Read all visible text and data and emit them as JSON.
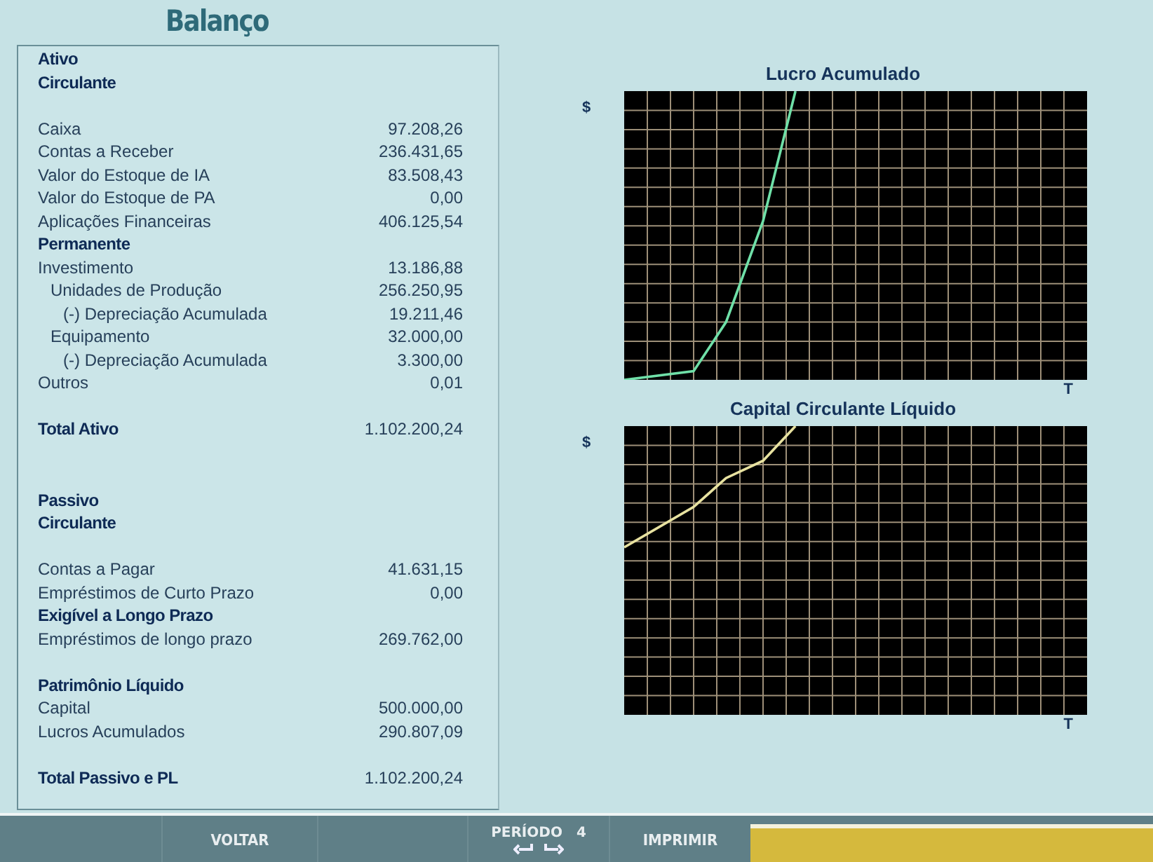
{
  "title": "Balanço",
  "assets": [
    {
      "kind": "heading",
      "label": "Ativo"
    },
    {
      "kind": "heading",
      "label": "Circulante"
    },
    {
      "kind": "item",
      "label": "Caixa",
      "value": "97.208,26",
      "spaced": true
    },
    {
      "kind": "item",
      "label": "Contas a Receber",
      "value": "236.431,65"
    },
    {
      "kind": "item",
      "label": "Valor do Estoque de IA",
      "value": "83.508,43"
    },
    {
      "kind": "item",
      "label": "Valor do Estoque de PA",
      "value": "0,00"
    },
    {
      "kind": "item",
      "label": "Aplicações Financeiras",
      "value": "406.125,54"
    },
    {
      "kind": "heading",
      "label": "Permanente"
    },
    {
      "kind": "item",
      "label": "Investimento",
      "value": "13.186,88",
      "children": [
        {
          "kind": "item",
          "label": "Unidades de Produção",
          "value": "256.250,95",
          "children": [
            {
              "kind": "item",
              "label": "(-) Depreciação Acumulada",
              "value": "19.211,46"
            }
          ]
        },
        {
          "kind": "item",
          "label": "Equipamento",
          "value": "32.000,00",
          "children": [
            {
              "kind": "item",
              "label": "(-) Depreciação Acumulada",
              "value": "3.300,00"
            }
          ]
        }
      ]
    },
    {
      "kind": "item",
      "label": "Outros",
      "value": "0,01"
    },
    {
      "kind": "total",
      "label": "Total Ativo",
      "value": "1.102.200,24",
      "spaced": true
    }
  ],
  "liabilities": [
    {
      "kind": "heading",
      "label": "Passivo"
    },
    {
      "kind": "heading",
      "label": "Circulante"
    },
    {
      "kind": "item",
      "label": "Contas a Pagar",
      "value": "41.631,15",
      "spaced": true
    },
    {
      "kind": "item",
      "label": "Empréstimos de Curto Prazo",
      "value": "0,00"
    },
    {
      "kind": "heading",
      "label": "Exigível a Longo Prazo"
    },
    {
      "kind": "item",
      "label": "Empréstimos de longo prazo",
      "value": "269.762,00"
    },
    {
      "kind": "heading",
      "label": "Patrimônio Líquido",
      "spaced": true
    },
    {
      "kind": "item",
      "label": "Capital",
      "value": "500.000,00"
    },
    {
      "kind": "item",
      "label": "Lucros Acumulados",
      "value": "290.807,09"
    },
    {
      "kind": "total",
      "label": "Total Passivo e PL",
      "value": "1.102.200,24",
      "spaced": true
    }
  ],
  "charts": [
    {
      "title": "Lucro Acumulado",
      "y_label": "$",
      "x_label": "T",
      "color": "#6fe0a8",
      "kind": "steep"
    },
    {
      "title": "Capital Circulante Líquido",
      "y_label": "$",
      "x_label": "T",
      "color": "#e8e2a0",
      "kind": "gentle"
    }
  ],
  "footer": {
    "back": "VOLTAR",
    "period_label": "PERÍODO",
    "period": "4",
    "print": "IMPRIMIR"
  }
}
